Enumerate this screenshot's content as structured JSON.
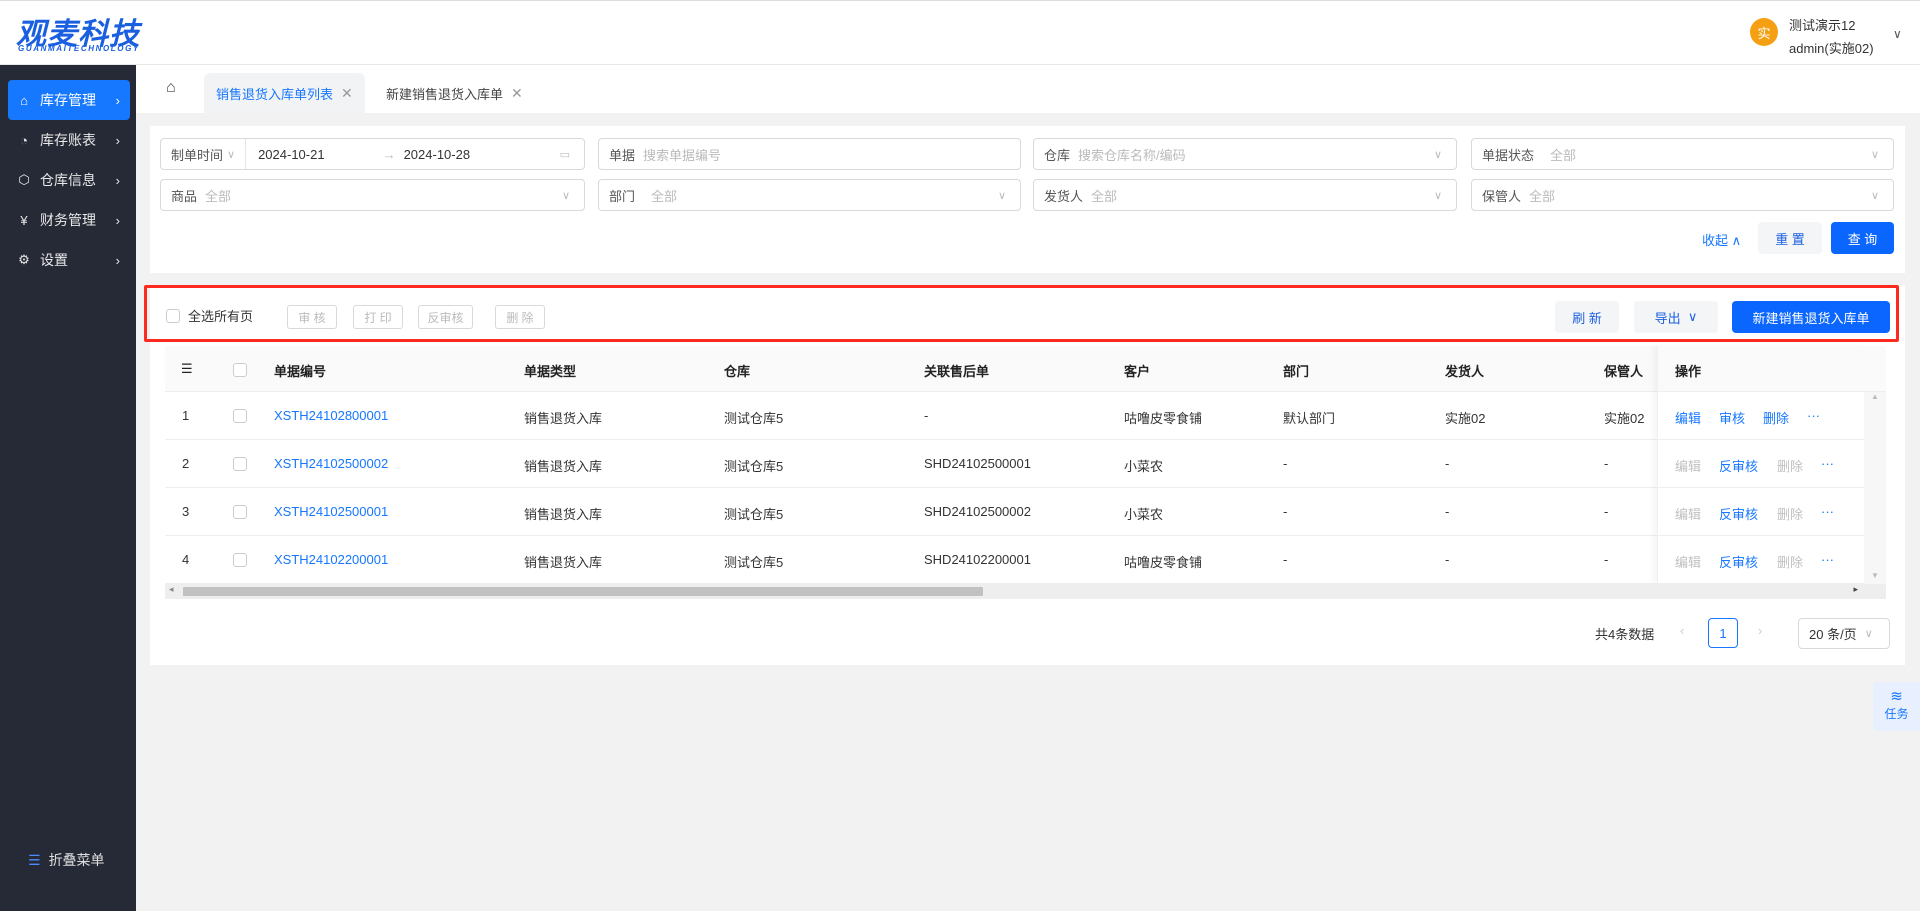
{
  "header": {
    "logo_cn": "观麦科技",
    "logo_en": "GUANMAITECHNOLOGY",
    "avatar_char": "实",
    "user_name": "测试演示12",
    "user_account": "admin(实施02)"
  },
  "sidebar": {
    "items": [
      {
        "label": "库存管理",
        "icon": "home-icon",
        "active": true
      },
      {
        "label": "库存账表",
        "icon": "pie-chart-icon"
      },
      {
        "label": "仓库信息",
        "icon": "box-icon"
      },
      {
        "label": "财务管理",
        "icon": "finance-icon"
      },
      {
        "label": "设置",
        "icon": "gear-icon"
      }
    ],
    "collapse_label": "折叠菜单"
  },
  "tabs": [
    {
      "label": "销售退货入库单列表",
      "active": true
    },
    {
      "label": "新建销售退货入库单"
    }
  ],
  "filters": {
    "date": {
      "type_label": "制单时间",
      "start": "2024-10-21",
      "end": "2024-10-28"
    },
    "doc": {
      "label": "单据",
      "placeholder": "搜索单据编号"
    },
    "warehouse": {
      "label": "仓库",
      "placeholder": "搜索仓库名称/编码"
    },
    "status": {
      "label": "单据状态",
      "value": "全部"
    },
    "product": {
      "label": "商品",
      "value": "全部"
    },
    "dept": {
      "label": "部门",
      "value": "全部"
    },
    "shipper": {
      "label": "发货人",
      "value": "全部"
    },
    "keeper": {
      "label": "保管人",
      "value": "全部"
    },
    "collapse": "收起",
    "reset": "重 置",
    "query": "查 询"
  },
  "toolbar": {
    "select_all": "全选所有页",
    "audit": "审 核",
    "print": "打 印",
    "unaudit": "反审核",
    "delete": "删 除",
    "refresh": "刷 新",
    "export": "导出",
    "create": "新建销售退货入库单"
  },
  "table": {
    "columns": [
      "单据编号",
      "单据类型",
      "仓库",
      "关联售后单",
      "客户",
      "部门",
      "发货人",
      "保管人",
      "操作"
    ],
    "rows": [
      {
        "idx": "1",
        "code": "XSTH24102800001",
        "type": "销售退货入库",
        "warehouse": "测试仓库5",
        "after_sale": "-",
        "customer": "咕噜皮零食铺",
        "dept": "默认部门",
        "shipper": "实施02",
        "keeper": "实施02",
        "actions": [
          "编辑",
          "审核",
          "删除",
          "···"
        ],
        "enabled": [
          true,
          true,
          true,
          true
        ]
      },
      {
        "idx": "2",
        "code": "XSTH24102500002",
        "type": "销售退货入库",
        "warehouse": "测试仓库5",
        "after_sale": "SHD24102500001",
        "customer": "小菜农",
        "dept": "-",
        "shipper": "-",
        "keeper": "-",
        "actions": [
          "编辑",
          "反审核",
          "删除",
          "···"
        ],
        "enabled": [
          false,
          true,
          false,
          true
        ]
      },
      {
        "idx": "3",
        "code": "XSTH24102500001",
        "type": "销售退货入库",
        "warehouse": "测试仓库5",
        "after_sale": "SHD24102500002",
        "customer": "小菜农",
        "dept": "-",
        "shipper": "-",
        "keeper": "-",
        "actions": [
          "编辑",
          "反审核",
          "删除",
          "···"
        ],
        "enabled": [
          false,
          true,
          false,
          true
        ]
      },
      {
        "idx": "4",
        "code": "XSTH24102200001",
        "type": "销售退货入库",
        "warehouse": "测试仓库5",
        "after_sale": "SHD24102200001",
        "customer": "咕噜皮零食铺",
        "dept": "-",
        "shipper": "-",
        "keeper": "-",
        "actions": [
          "编辑",
          "反审核",
          "删除",
          "···"
        ],
        "enabled": [
          false,
          true,
          false,
          true
        ]
      }
    ]
  },
  "pagination": {
    "total": "共4条数据",
    "current": "1",
    "page_size": "20 条/页"
  },
  "task_float": {
    "label": "任务"
  },
  "colors": {
    "accent": "#0a66ff",
    "sidebar": "#262a36",
    "highlight": "#ff2a1f"
  }
}
